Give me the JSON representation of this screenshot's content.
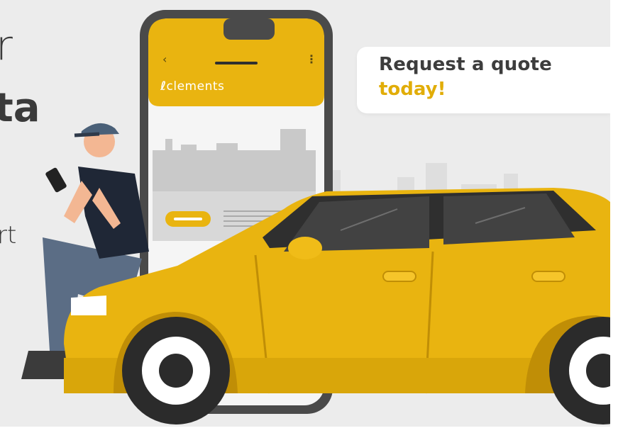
{
  "left_text": {
    "line1": "r",
    "line2": "ta",
    "line3": "rt"
  },
  "quote": {
    "line1": "Request a quote",
    "line2": "today!"
  },
  "phone": {
    "logo_mark": "ℓ",
    "logo_text": "clements",
    "back_icon": "chevron-left-icon",
    "menu_icon": "kebab-menu-icon"
  },
  "colors": {
    "brand_yellow": "#E9B410",
    "dark_text": "#3D3D3D",
    "accent_text": "#E1AD08",
    "background": "#ECECEC"
  }
}
